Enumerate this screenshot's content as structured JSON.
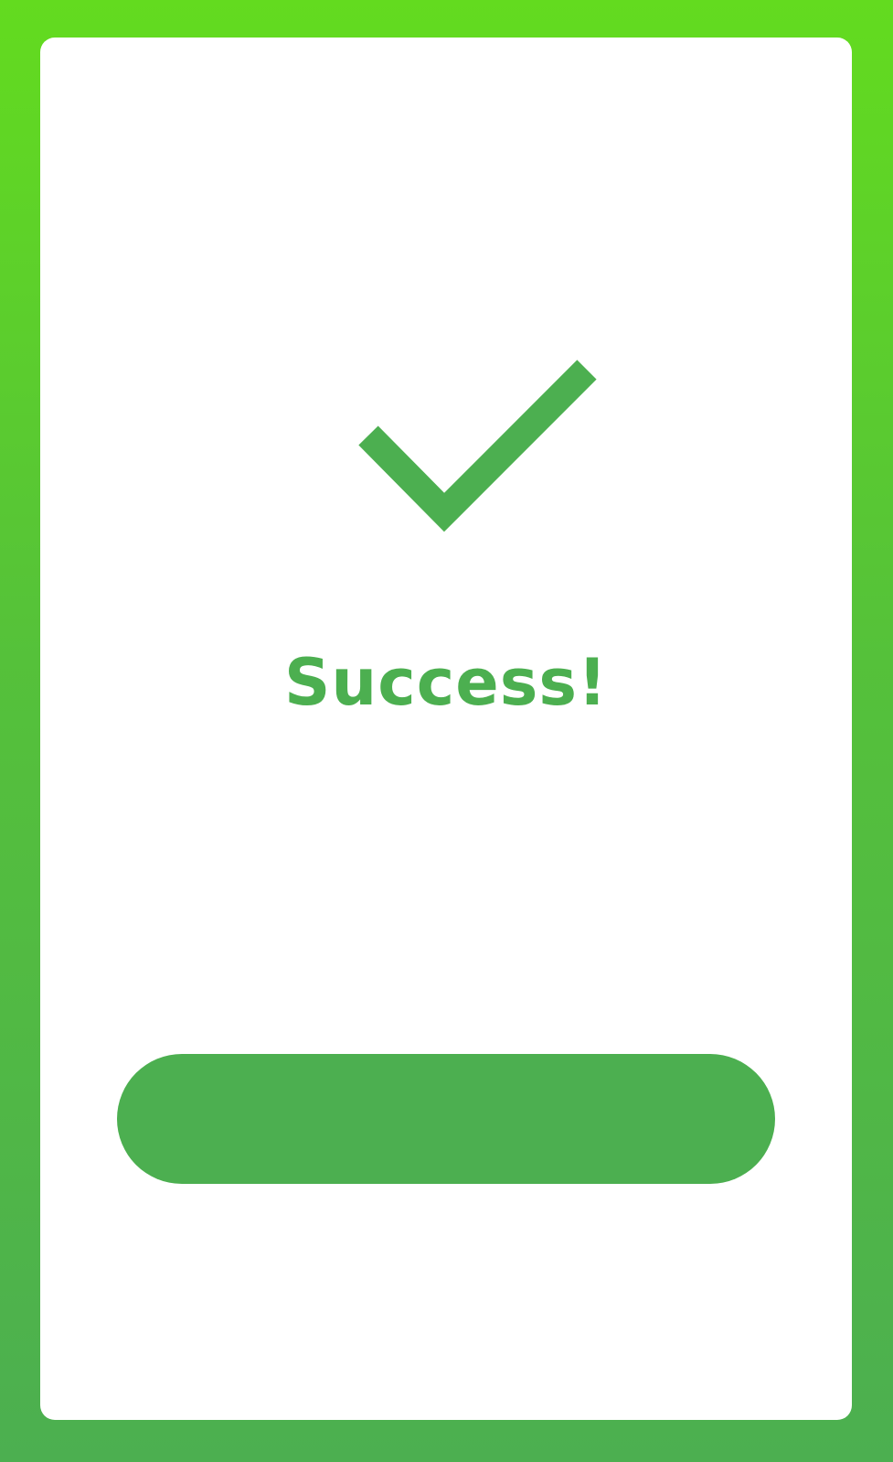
{
  "dialog": {
    "title": "Success!",
    "message": "",
    "button_label": "",
    "icon": "checkmark-icon"
  },
  "colors": {
    "accent": "#4caf50",
    "background_top": "#63db1f",
    "background_bottom": "#4caf50",
    "card": "#ffffff"
  }
}
